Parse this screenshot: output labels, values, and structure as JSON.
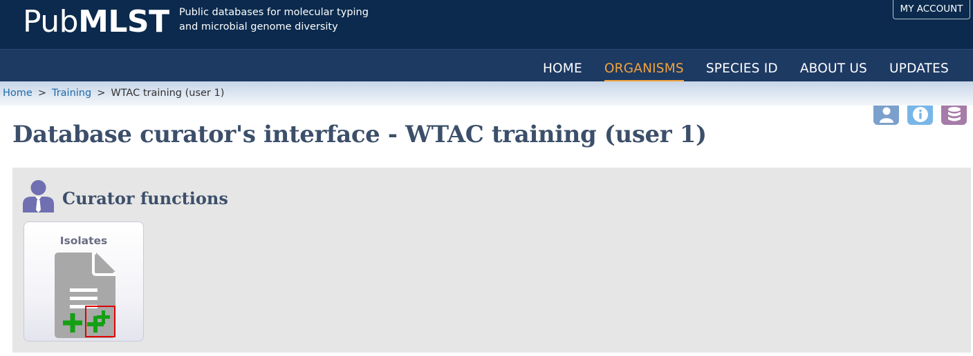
{
  "header": {
    "logo_part1": "Pub",
    "logo_part2": "MLST",
    "tagline_line1": "Public databases for molecular typing",
    "tagline_line2": "and microbial genome diversity",
    "account_button": "MY ACCOUNT"
  },
  "nav": {
    "items": [
      {
        "label": "HOME"
      },
      {
        "label": "ORGANISMS"
      },
      {
        "label": "SPECIES ID"
      },
      {
        "label": "ABOUT US"
      },
      {
        "label": "UPDATES"
      }
    ],
    "active": "ORGANISMS"
  },
  "breadcrumb": {
    "items": [
      "Home",
      "Training",
      "WTAC training (user 1)"
    ],
    "separator": ">"
  },
  "top_icons": [
    "user-icon",
    "info-icon",
    "database-icon"
  ],
  "page": {
    "title": "Database curator's interface - WTAC training (user 1)"
  },
  "panel": {
    "heading": "Curator functions",
    "icon": "curator-icon",
    "cards": [
      {
        "title": "Isolates",
        "icon": "document-icon",
        "actions": [
          "add-isolate-icon",
          "batch-add-isolates-icon"
        ]
      }
    ]
  },
  "colors": {
    "header_bg": "#0b2a4d",
    "nav_bg": "#1d3a63",
    "nav_active": "#f1a23c",
    "link": "#1f6aa8",
    "title": "#3c4f6a",
    "panel_bg": "#e6e6e6",
    "add_green": "#14a014",
    "highlight_red": "#e00000"
  }
}
